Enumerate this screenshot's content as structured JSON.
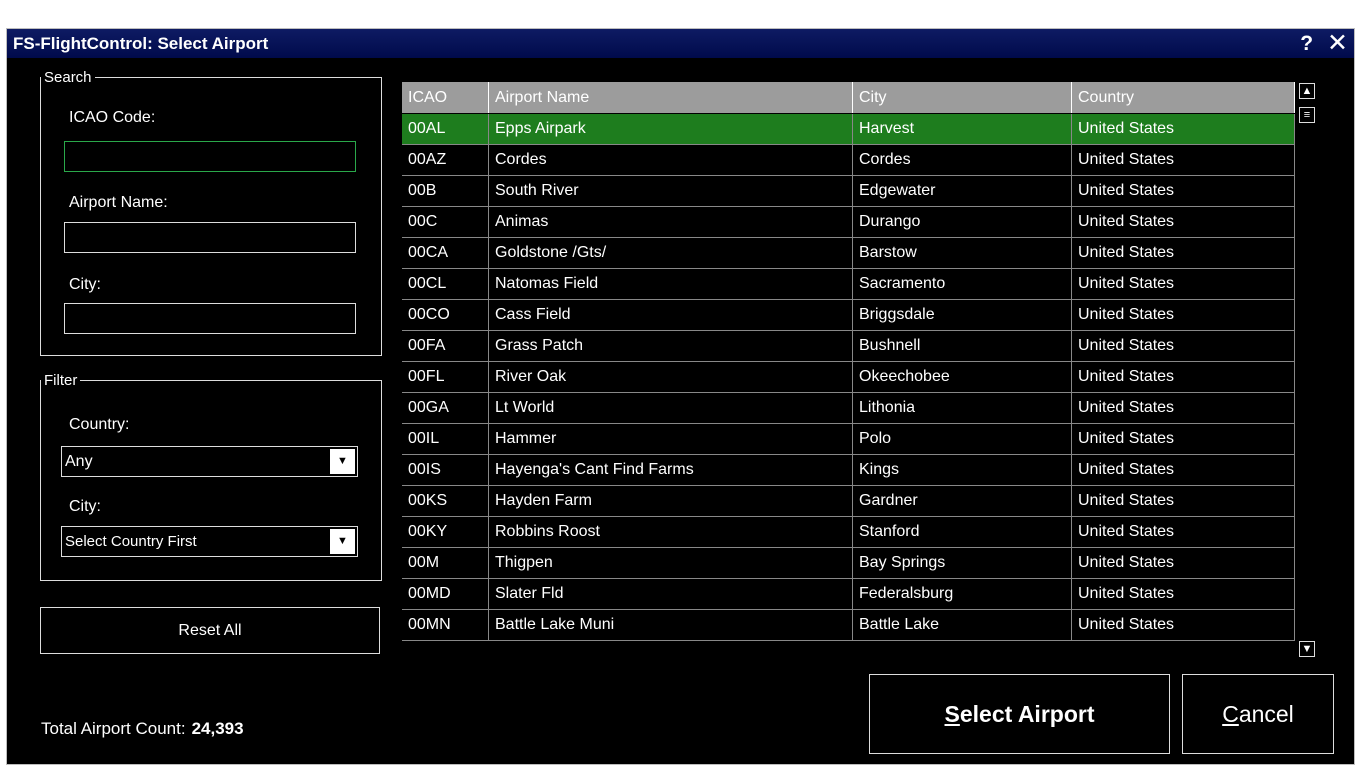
{
  "window": {
    "title": "FS-FlightControl: Select Airport",
    "help": "?",
    "close": "✕"
  },
  "search": {
    "legend": "Search",
    "icao_label": "ICAO Code:",
    "icao_value": "",
    "name_label": "Airport Name:",
    "name_value": "",
    "city_label": "City:",
    "city_value": ""
  },
  "filter": {
    "legend": "Filter",
    "country_label": "Country:",
    "country_value": "Any",
    "city_label": "City:",
    "city_value": "Select Country First"
  },
  "reset_label": "Reset All",
  "count_label": "Total Airport Count:",
  "count_value": "24,393",
  "select_label_first": "S",
  "select_label_rest": "elect Airport",
  "cancel_label_first": "C",
  "cancel_label_rest": "ancel",
  "table": {
    "headers": [
      "ICAO",
      "Airport Name",
      "City",
      "Country"
    ],
    "selected_index": 0,
    "rows": [
      [
        "00AL",
        "Epps Airpark",
        "Harvest",
        "United States"
      ],
      [
        "00AZ",
        "Cordes",
        "Cordes",
        "United States"
      ],
      [
        "00B",
        "South River",
        "Edgewater",
        "United States"
      ],
      [
        "00C",
        "Animas",
        "Durango",
        "United States"
      ],
      [
        "00CA",
        "Goldstone /Gts/",
        "Barstow",
        "United States"
      ],
      [
        "00CL",
        "Natomas Field",
        "Sacramento",
        "United States"
      ],
      [
        "00CO",
        "Cass Field",
        "Briggsdale",
        "United States"
      ],
      [
        "00FA",
        "Grass Patch",
        "Bushnell",
        "United States"
      ],
      [
        "00FL",
        "River Oak",
        "Okeechobee",
        "United States"
      ],
      [
        "00GA",
        "Lt World",
        "Lithonia",
        "United States"
      ],
      [
        "00IL",
        "Hammer",
        "Polo",
        "United States"
      ],
      [
        "00IS",
        "Hayenga's Cant Find Farms",
        "Kings",
        "United States"
      ],
      [
        "00KS",
        "Hayden Farm",
        "Gardner",
        "United States"
      ],
      [
        "00KY",
        "Robbins Roost",
        "Stanford",
        "United States"
      ],
      [
        "00M",
        "Thigpen",
        "Bay Springs",
        "United States"
      ],
      [
        "00MD",
        "Slater Fld",
        "Federalsburg",
        "United States"
      ],
      [
        "00MN",
        "Battle Lake Muni",
        "Battle Lake",
        "United States"
      ]
    ]
  }
}
